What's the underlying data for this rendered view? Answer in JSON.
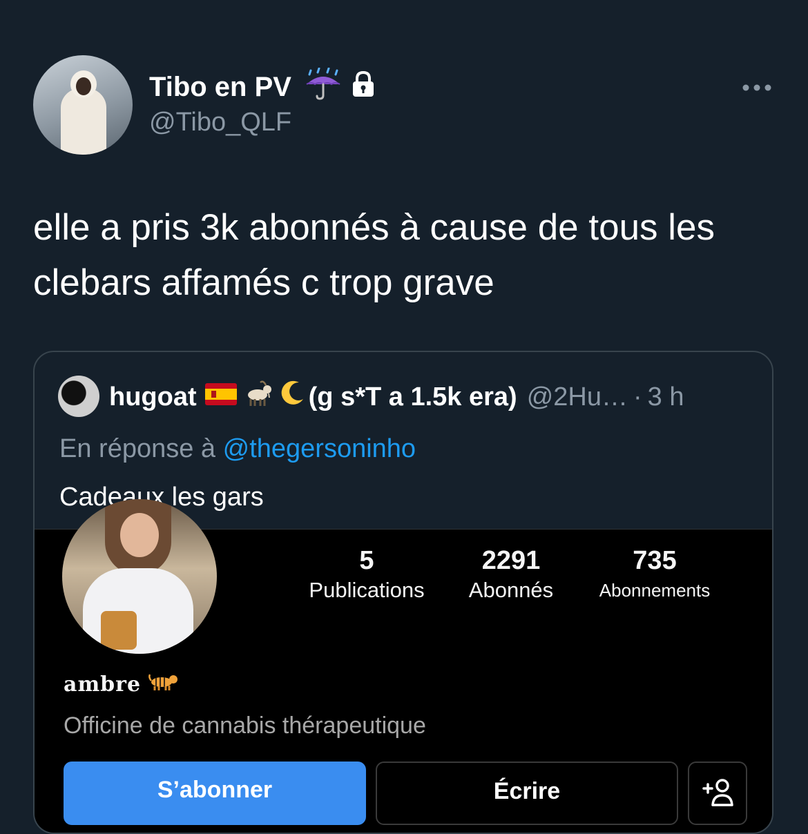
{
  "tweet": {
    "author": {
      "display_name": "Tibo en PV",
      "handle": "@Tibo_QLF",
      "name_icons": [
        "umbrella-with-rain-icon",
        "lock-icon"
      ]
    },
    "more_icon": "more-horizontal-icon",
    "text": "elle a pris 3k abonnés à cause de tous les clebars affamés c trop grave"
  },
  "quote": {
    "author": {
      "display_name": "hugoat",
      "name_emoji": [
        "spain-flag-icon",
        "goat-icon",
        "crescent-moon-icon"
      ],
      "name_suffix": "(g s*T a 1.5k era)",
      "handle": "@2Hu…",
      "separator": "·",
      "time": "3 h"
    },
    "reply_prefix": "En réponse à",
    "reply_mention": "@thegersoninho",
    "text": "Cadeaux les gars",
    "instagram": {
      "stats": [
        {
          "value": "5",
          "label": "Publications"
        },
        {
          "value": "2291",
          "label": "Abonnés"
        },
        {
          "value": "735",
          "label": "Abonnements"
        }
      ],
      "name": "ambre",
      "name_emoji": "tiger-icon",
      "bio": "Officine de cannabis thérapeutique",
      "buttons": {
        "follow": "S’abonner",
        "message": "Écrire",
        "add_user_icon": "add-user-icon"
      },
      "accent": "#3a8df0"
    }
  },
  "colors": {
    "background": "#15202b",
    "secondary_text": "#8b98a5",
    "link": "#1d9bf0",
    "border": "#38444d"
  }
}
